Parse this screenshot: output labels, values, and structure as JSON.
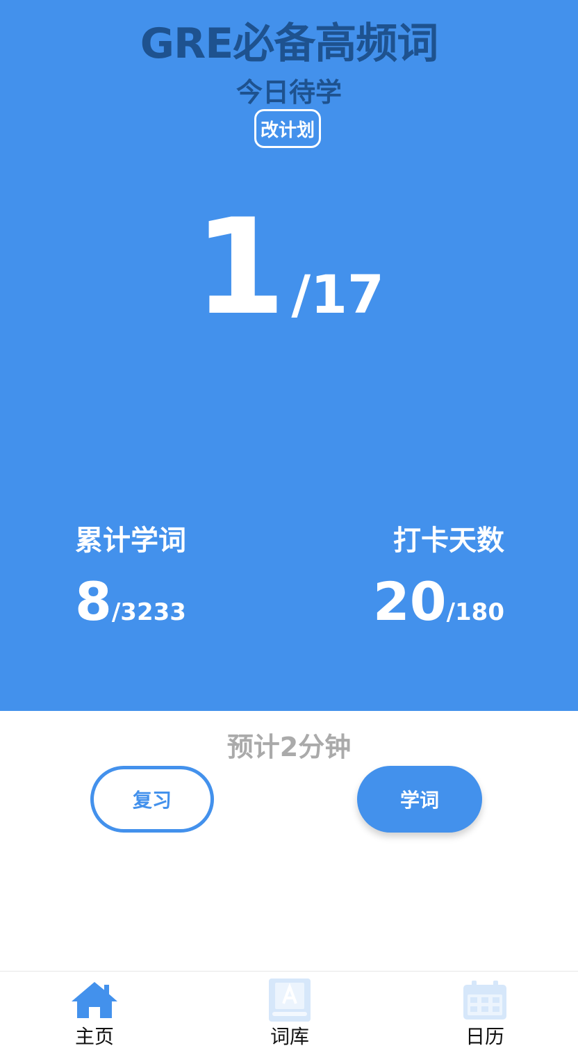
{
  "header": {
    "book_title": "GRE必备高频词",
    "today_label": "今日待学",
    "change_plan_label": "改计划"
  },
  "today": {
    "learned": "1",
    "total": "/17"
  },
  "stats": {
    "cumulative": {
      "label": "累计学词",
      "value": "8",
      "total": "/3233"
    },
    "checkin": {
      "label": "打卡天数",
      "value": "20",
      "total": "/180"
    }
  },
  "estimate_text": "预计2分钟",
  "actions": {
    "review_label": "复习",
    "learn_label": "学词"
  },
  "tabbar": {
    "items": [
      {
        "label": "主页",
        "icon": "home-icon",
        "active": true
      },
      {
        "label": "词库",
        "icon": "book-icon",
        "active": false
      },
      {
        "label": "日历",
        "icon": "calendar-icon",
        "active": false
      }
    ]
  },
  "colors": {
    "accent": "#4391ec",
    "title_dark": "#1e528f",
    "muted": "#aaaaaa",
    "icon_inactive": "#d6e7fa"
  }
}
